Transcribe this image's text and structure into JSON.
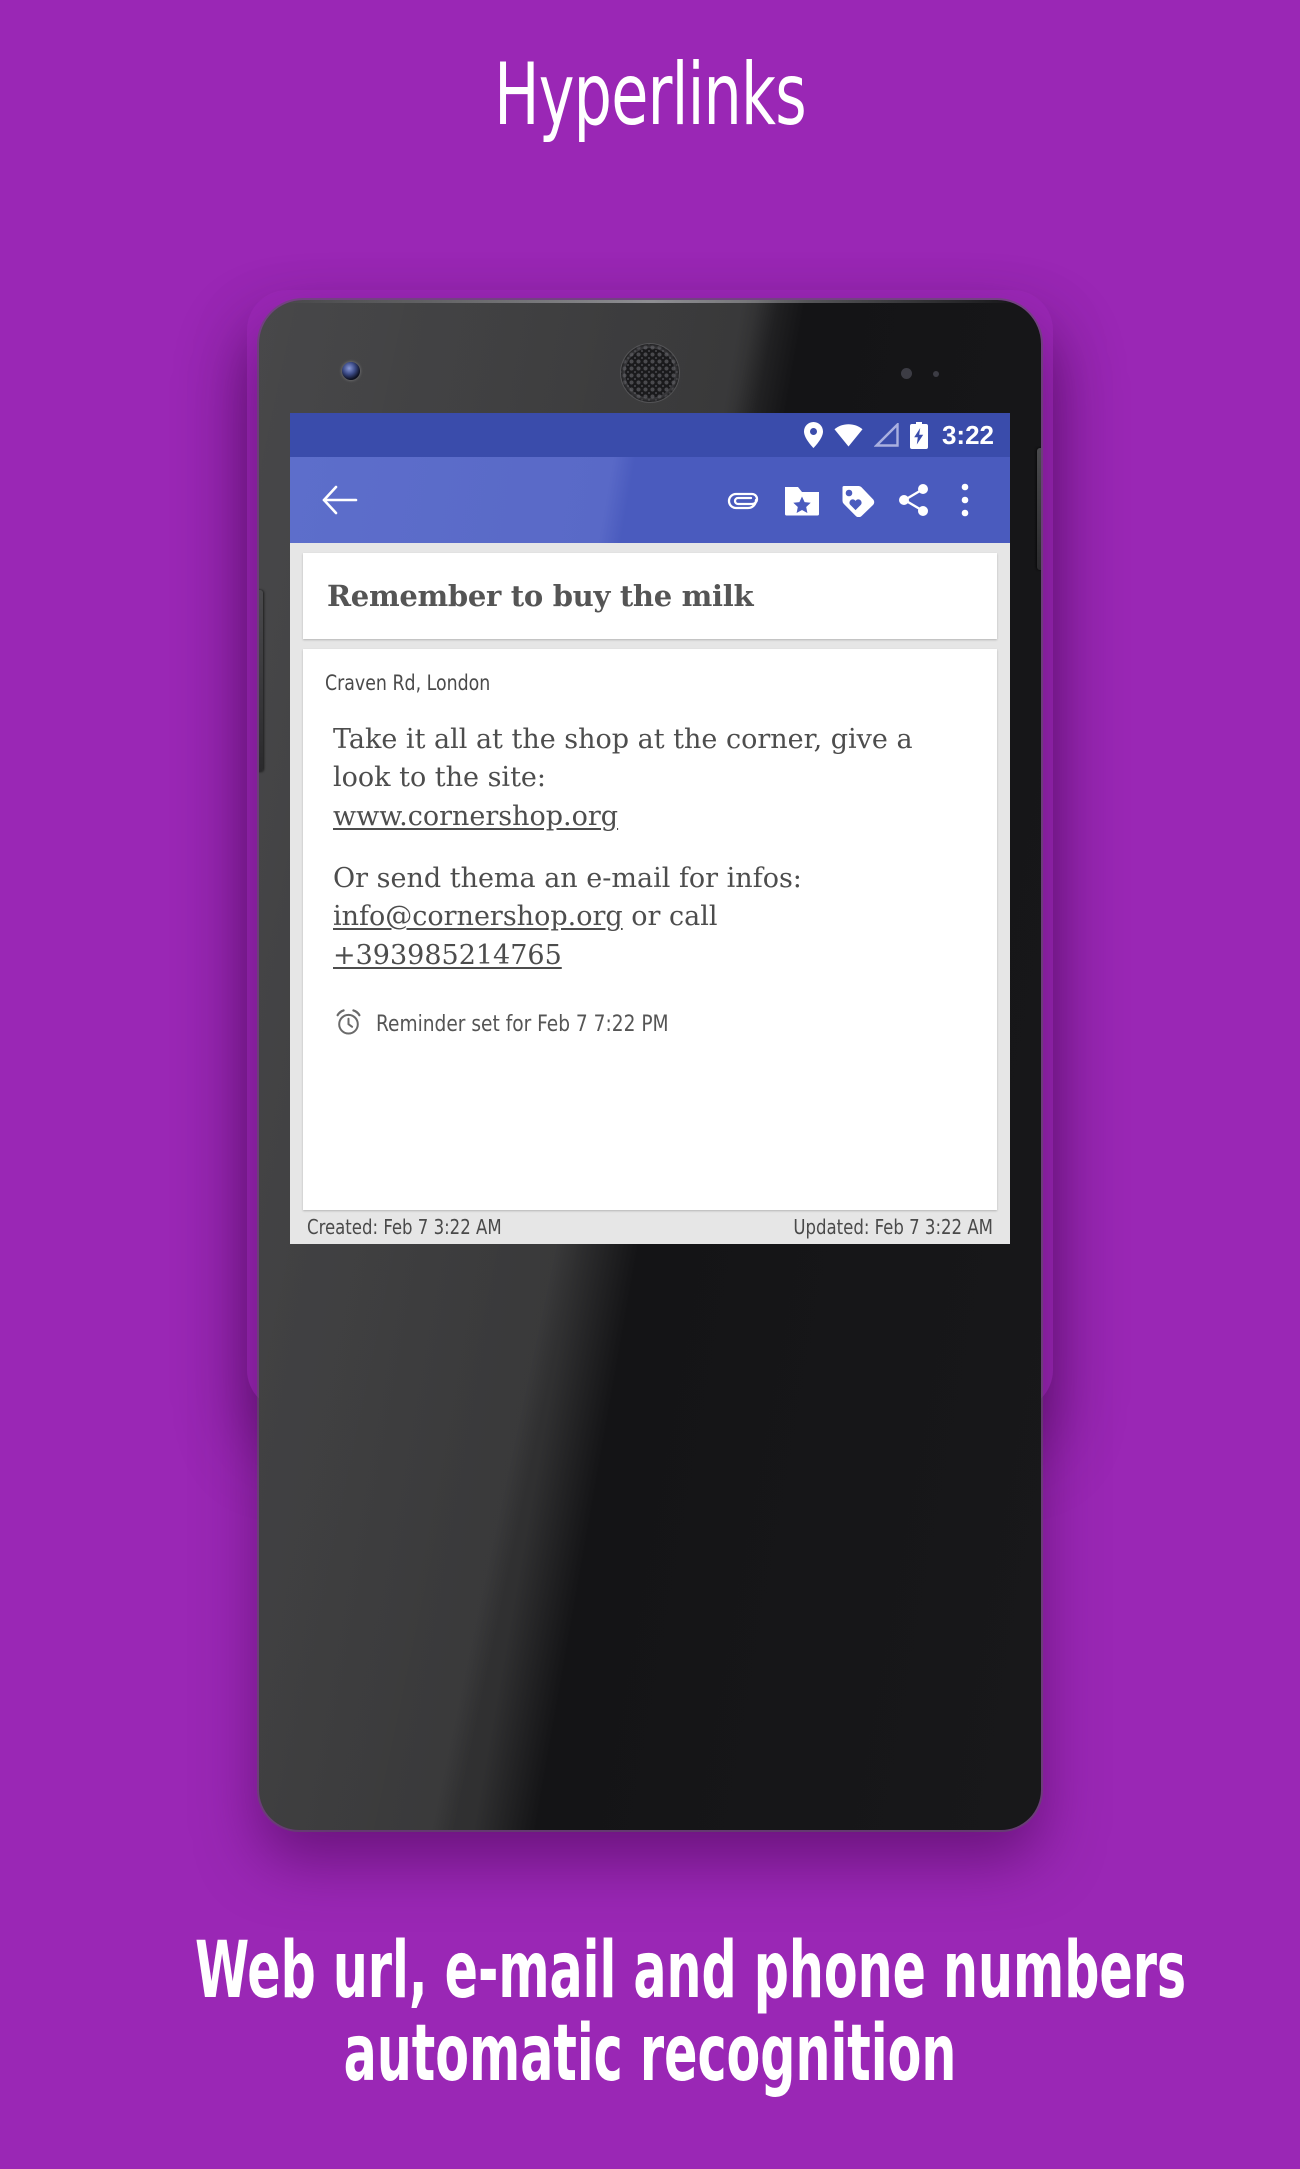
{
  "headline": "Hyperlinks",
  "caption": {
    "line1": "Web url, e-mail and phone numbers",
    "line2": "automatic recognition"
  },
  "colors": {
    "background_purple": "#9a27b5",
    "statusbar_blue": "#3a4cab",
    "toolbar_blue": "#4a5bbe",
    "navbar_gray": "#9a9a9a",
    "text_gray": "#4d4d4d"
  },
  "statusbar": {
    "icons": [
      "location-pin-icon",
      "wifi-icon",
      "signal-icon",
      "battery-charging-icon"
    ],
    "time": "3:22"
  },
  "toolbar": {
    "back_label": "back-arrow",
    "actions": [
      {
        "name": "attachment-icon",
        "label": "Attachment"
      },
      {
        "name": "folder-star-icon",
        "label": "Folder"
      },
      {
        "name": "tag-icon",
        "label": "Tag"
      },
      {
        "name": "share-icon",
        "label": "Share"
      },
      {
        "name": "overflow-menu-icon",
        "label": "More options"
      }
    ]
  },
  "note": {
    "title": "Remember to buy the milk",
    "location": "Craven Rd, London",
    "paragraph1_pre": "Take it all at the shop at the corner, give a look to the site:",
    "link_url": "www.cornershop.org",
    "paragraph2_pre": "Or send thema an e-mail for infos:",
    "link_email": "info@cornershop.org",
    "paragraph2_mid": " or call ",
    "link_phone": "+393985214765",
    "reminder_text": "Reminder set for Feb 7 7:22 PM",
    "created": "Created: Feb 7 3:22 AM",
    "updated": "Updated: Feb 7 3:22 AM"
  },
  "navbar": {
    "back": "back-triangle-icon",
    "home": "home-circle-icon",
    "recents": "recents-square-icon"
  }
}
